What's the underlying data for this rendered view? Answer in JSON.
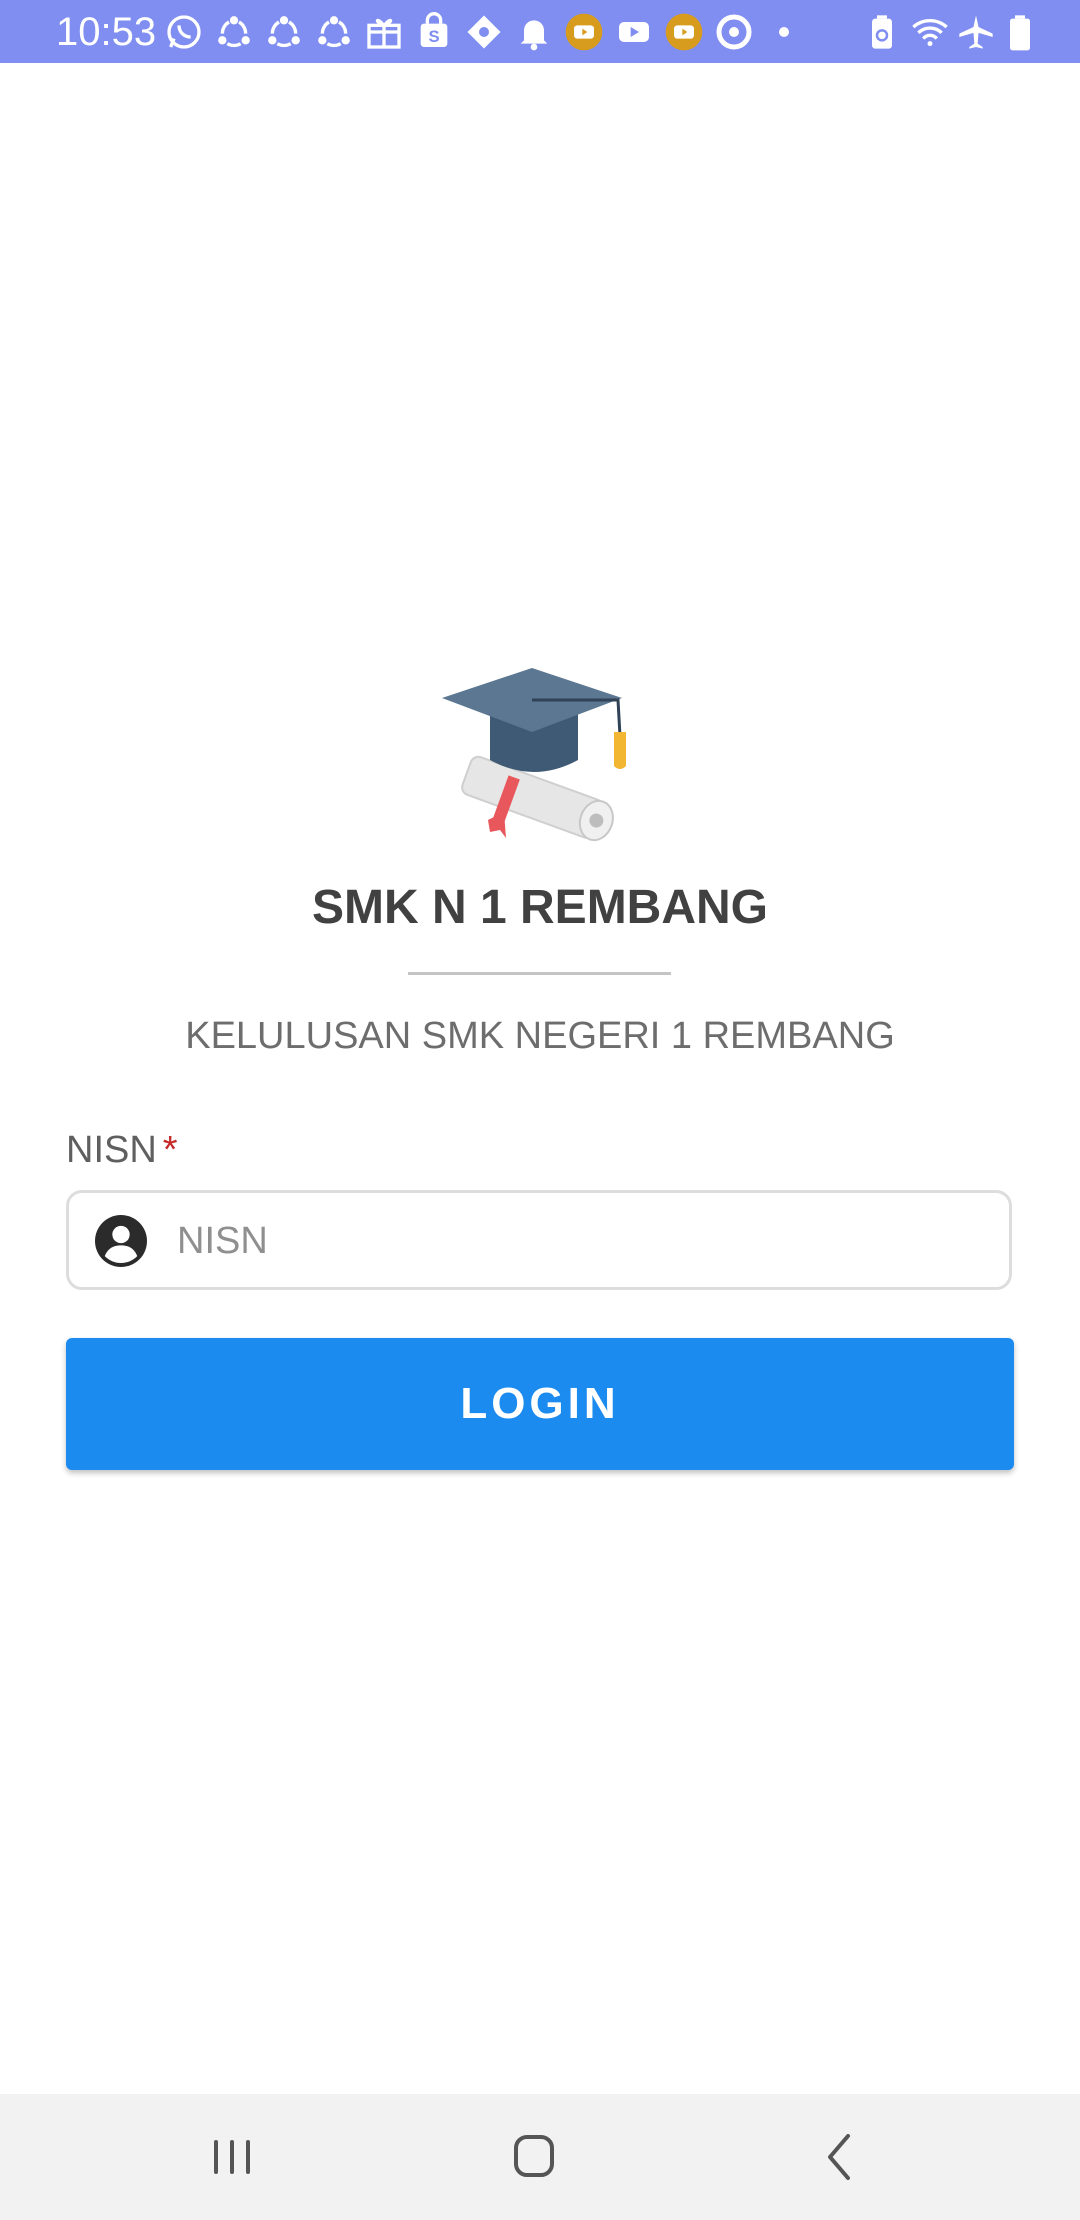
{
  "status_bar": {
    "time": "10:53",
    "background_color": "#7f8ef0",
    "notification_icons": [
      "whatsapp-icon",
      "sync-icon",
      "sync-icon",
      "sync-icon",
      "gift-icon",
      "shop-icon",
      "diamond-icon",
      "bell-icon",
      "youtube-icon",
      "youtube-icon",
      "youtube-icon",
      "circle-icon",
      "dot-icon"
    ],
    "system_icons": [
      "battery-saver-icon",
      "wifi-icon",
      "airplane-icon",
      "battery-icon"
    ]
  },
  "header": {
    "logo_icon": "graduation-cap-diploma-icon",
    "title": "SMK N 1 REMBANG",
    "subtitle": "KELULUSAN SMK NEGERI 1 REMBANG"
  },
  "form": {
    "nisn_label": "NISN",
    "required_marker": "*",
    "nisn_placeholder": "NISN",
    "nisn_value": "",
    "nisn_icon": "user-circle-icon",
    "login_label": "LOGIN",
    "accent_color": "#1b8bef"
  },
  "nav_bar": {
    "buttons": [
      "recent-apps-icon",
      "home-icon",
      "back-icon"
    ]
  }
}
